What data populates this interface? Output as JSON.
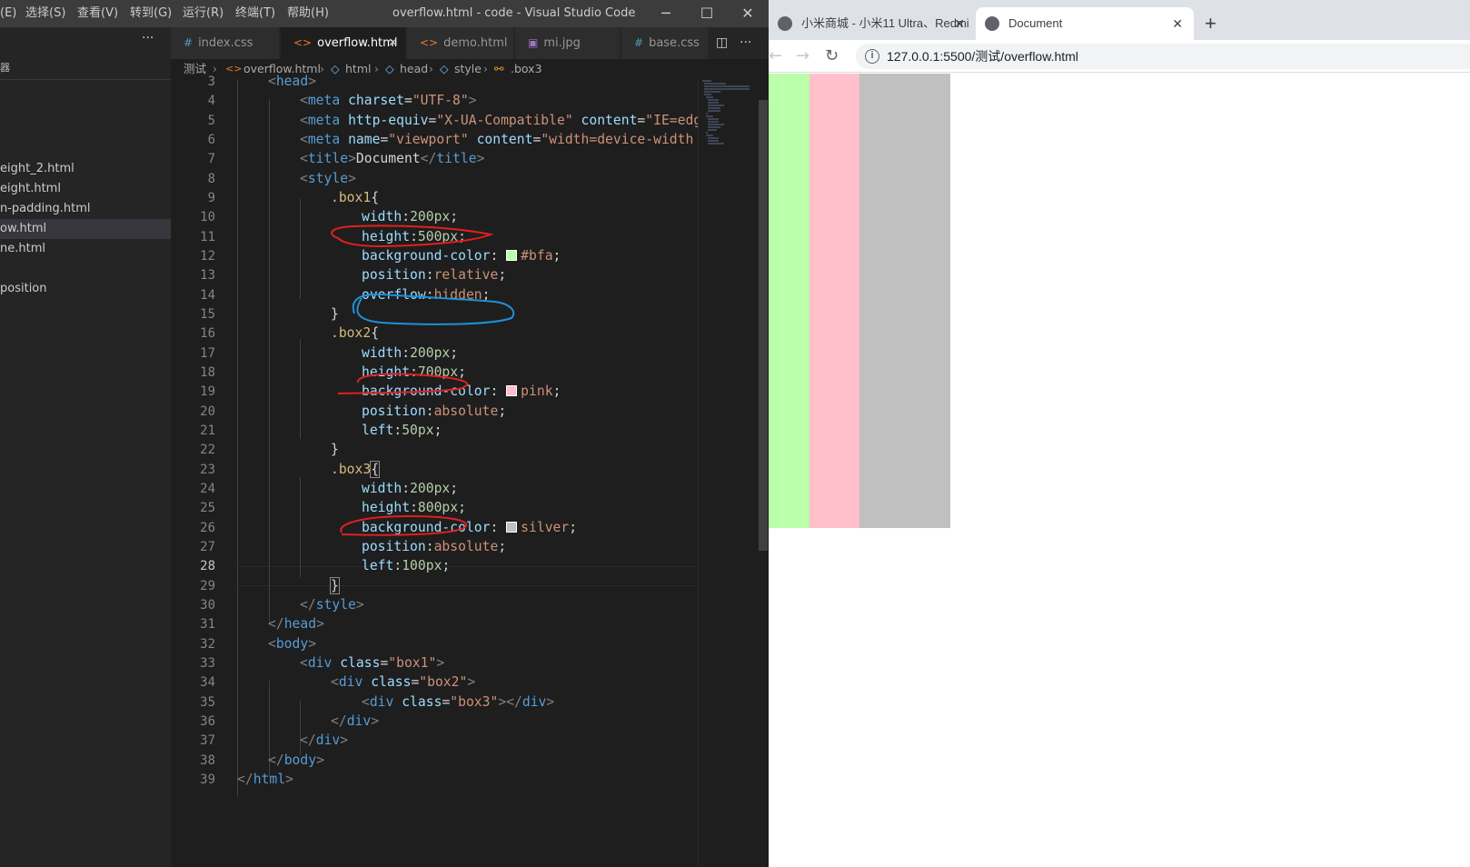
{
  "vscode": {
    "menu": [
      "(E)",
      "选择(S)",
      "查看(V)",
      "转到(G)",
      "运行(R)",
      "终端(T)",
      "帮助(H)"
    ],
    "window_title": "overflow.html - code - Visual Studio Code",
    "window_controls": {
      "minimize": "─",
      "maximize": "☐",
      "close": "✕"
    },
    "sidebar": {
      "more": "···",
      "header": "器",
      "files": [
        "eight_2.html",
        "eight.html",
        "n-padding.html",
        "ow.html",
        "ne.html",
        "position"
      ]
    },
    "tabs": [
      {
        "icon": "#",
        "label": "index.css"
      },
      {
        "icon": "<>",
        "label": "overflow.html",
        "close": "✕"
      },
      {
        "icon": "<>",
        "label": "demo.html"
      },
      {
        "icon": "▣",
        "label": "mi.jpg"
      },
      {
        "icon": "#",
        "label": "base.css"
      }
    ],
    "tab_actions": {
      "split": "◫",
      "more": "···"
    },
    "breadcrumb": [
      "测试",
      "overflow.html",
      "html",
      "head",
      "style",
      ".box3"
    ],
    "line_numbers": [
      "3",
      "4",
      "5",
      "6",
      "7",
      "8",
      "9",
      "10",
      "11",
      "12",
      "13",
      "14",
      "15",
      "16",
      "17",
      "18",
      "19",
      "20",
      "21",
      "22",
      "23",
      "24",
      "25",
      "26",
      "27",
      "28",
      "29",
      "30",
      "31",
      "32",
      "33",
      "34",
      "35",
      "36",
      "37",
      "38",
      "39"
    ],
    "active_line": "28",
    "code": {
      "l3_head": "head",
      "l4_tag": "meta",
      "l4_attr": "charset",
      "l4_val": "\"UTF-8\"",
      "l5_tag": "meta",
      "l5_attr1": "http-equiv",
      "l5_val1": "\"X-UA-Compatible\"",
      "l5_attr2": "content",
      "l5_val2": "\"IE=edg",
      "l6_tag": "meta",
      "l6_attr1": "name",
      "l6_val1": "\"viewport\"",
      "l6_attr2": "content",
      "l6_val2": "\"width=device-width",
      "l7_tag": "title",
      "l7_text": "Document",
      "l8_tag": "style",
      "box1_sel": ".box1",
      "box1_width_prop": "width",
      "box1_width_val": "200px",
      "box1_height_prop": "height",
      "box1_height_val": "500px",
      "box1_bg_prop": "background-color",
      "box1_bg_val": "#bfa",
      "box1_pos_prop": "position",
      "box1_pos_val": "relative",
      "box1_of_prop": "overflow",
      "box1_of_val": "hidden",
      "box2_sel": ".box2",
      "box2_width_prop": "width",
      "box2_width_val": "200px",
      "box2_height_prop": "height",
      "box2_height_val": "700px",
      "box2_bg_prop": "background-color",
      "box2_bg_val": "pink",
      "box2_pos_prop": "position",
      "box2_pos_val": "absolute",
      "box2_left_prop": "left",
      "box2_left_val": "50px",
      "box3_sel": ".box3",
      "box3_width_prop": "width",
      "box3_width_val": "200px",
      "box3_height_prop": "height",
      "box3_height_val": "800px",
      "box3_bg_prop": "background-color",
      "box3_bg_val": "silver",
      "box3_pos_prop": "position",
      "box3_pos_val": "absolute",
      "box3_left_prop": "left",
      "box3_left_val": "100px",
      "l30_tag": "style",
      "l31_tag": "head",
      "l32_tag": "body",
      "l33_tag": "div",
      "l33_attr": "class",
      "l33_val": "\"box1\"",
      "l34_tag": "div",
      "l34_attr": "class",
      "l34_val": "\"box2\"",
      "l35_tag": "div",
      "l35_attr": "class",
      "l35_val": "\"box3\"",
      "l35_close": "div",
      "l36_tag": "div",
      "l37_tag": "div",
      "l38_tag": "body",
      "l39_tag": "html"
    }
  },
  "chrome": {
    "tabs": [
      {
        "title": "小米商城 - 小米11 Ultra、Redmi",
        "close": "✕"
      },
      {
        "title": "Document",
        "close": "✕"
      }
    ],
    "new_tab": "+",
    "nav": {
      "back": "←",
      "forward": "→",
      "reload": "↻"
    },
    "info_icon": "i",
    "url": "127.0.0.1:5500/测试/overflow.html",
    "page_boxes": {
      "box1_color": "#bbffaa",
      "box2_color": "#ffc0cb",
      "box3_color": "#c0c0c0"
    }
  },
  "colors": {
    "annotation_red": "#e02020",
    "annotation_blue": "#1e90d6"
  }
}
